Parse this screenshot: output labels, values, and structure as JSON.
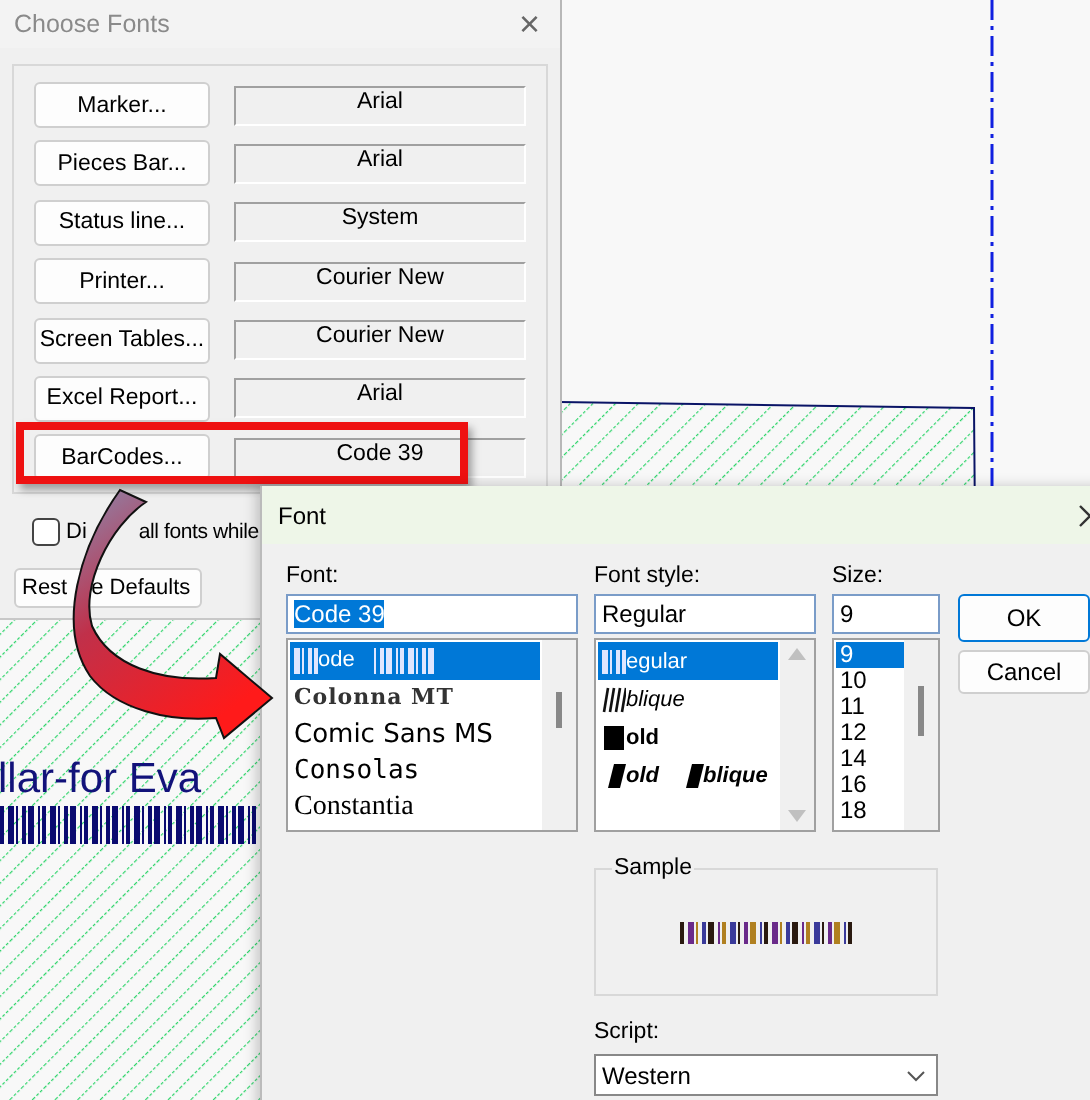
{
  "background": {
    "caption": "llar-for Eva"
  },
  "choose_fonts": {
    "title": "Choose Fonts",
    "close": "×",
    "rows": [
      {
        "button": "Marker...",
        "value": "Arial",
        "highlighted": false
      },
      {
        "button": "Pieces Bar...",
        "value": "Arial",
        "highlighted": false
      },
      {
        "button": "Status line...",
        "value": "System",
        "highlighted": false
      },
      {
        "button": "Printer...",
        "value": "Courier New",
        "highlighted": false
      },
      {
        "button": "Screen Tables...",
        "value": "Courier New",
        "highlighted": false
      },
      {
        "button": "Excel Report...",
        "value": "Arial",
        "highlighted": false
      },
      {
        "button": "BarCodes...",
        "value": "Code 39",
        "highlighted": true
      }
    ],
    "checkbox": {
      "label_parts": [
        "Di",
        "all fonts while"
      ],
      "checked": false
    },
    "restore_button_parts": [
      "Rest",
      "e Defaults"
    ]
  },
  "font_dialog": {
    "title": "Font",
    "font": {
      "label": "Font:",
      "value": "Code 39",
      "items": [
        {
          "text": "ode",
          "kind": "barcode",
          "selected": true
        },
        {
          "text": "Colonna MT",
          "kind": "colonna",
          "selected": false
        },
        {
          "text": "Comic Sans MS",
          "kind": "comic",
          "selected": false
        },
        {
          "text": "Consolas",
          "kind": "mono",
          "selected": false
        },
        {
          "text": "Constantia",
          "kind": "serif",
          "selected": false
        }
      ]
    },
    "style": {
      "label": "Font style:",
      "value": "Regular",
      "items": [
        {
          "parts": [
            "egular"
          ],
          "kind": "regular",
          "selected": true
        },
        {
          "parts": [
            "blique"
          ],
          "kind": "oblique",
          "selected": false
        },
        {
          "parts": [
            "old"
          ],
          "kind": "bold",
          "selected": false
        },
        {
          "parts": [
            "old",
            "blique"
          ],
          "kind": "bolditalic",
          "selected": false
        }
      ]
    },
    "size": {
      "label": "Size:",
      "value": "9",
      "items": [
        {
          "text": "9",
          "selected": true
        },
        {
          "text": "10",
          "selected": false
        },
        {
          "text": "11",
          "selected": false
        },
        {
          "text": "12",
          "selected": false
        },
        {
          "text": "14",
          "selected": false
        },
        {
          "text": "16",
          "selected": false
        },
        {
          "text": "18",
          "selected": false
        }
      ]
    },
    "buttons": [
      "OK",
      "Cancel"
    ],
    "sample": {
      "label": "Sample"
    },
    "script": {
      "label": "Script:",
      "value": "Western"
    }
  }
}
